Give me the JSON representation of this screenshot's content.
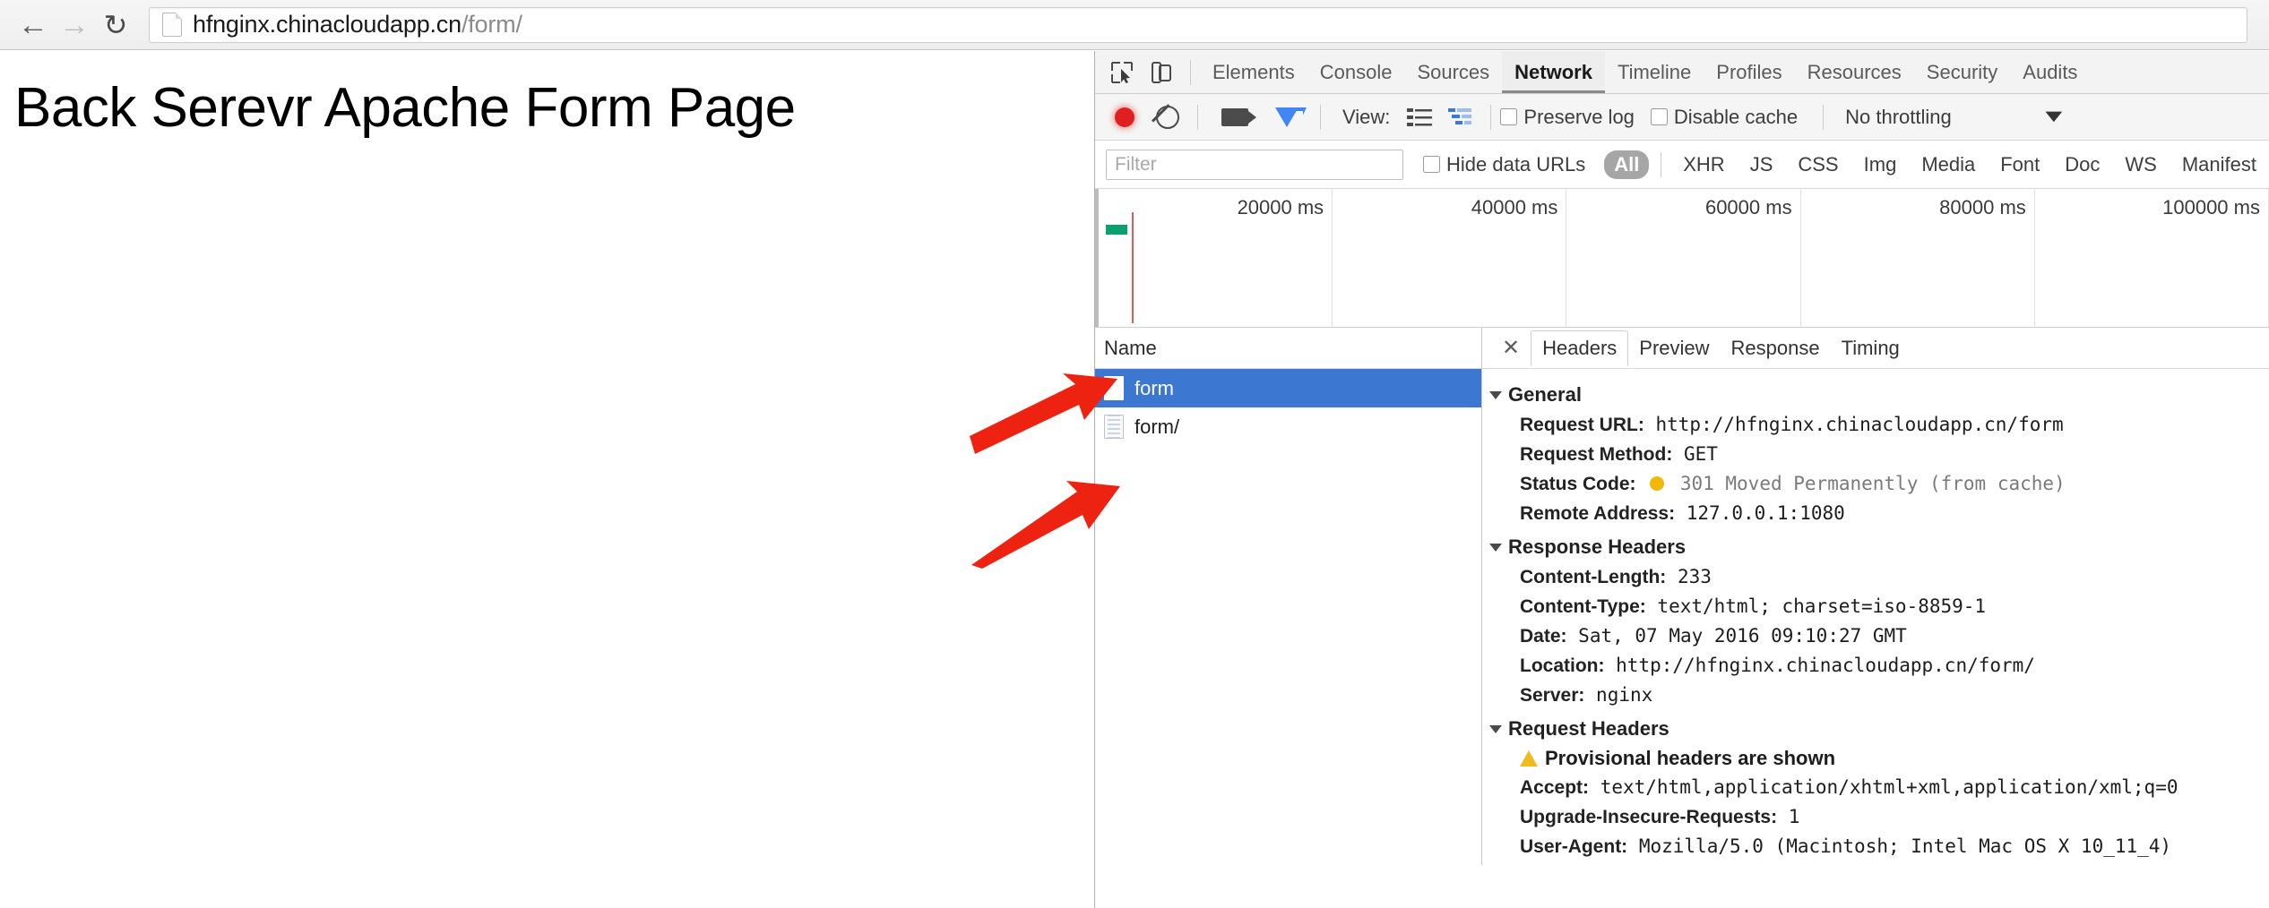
{
  "browser": {
    "back_icon": "back-arrow-icon",
    "forward_icon": "forward-arrow-icon",
    "reload_icon": "reload-icon",
    "url_main": "hfnginx.chinacloudapp.cn",
    "url_path": "/form/",
    "url_full": "hfnginx.chinacloudapp.cn/form/"
  },
  "page": {
    "heading": "Back Serevr Apache Form Page"
  },
  "devtools": {
    "panel_tabs": [
      {
        "label": "Elements",
        "active": false
      },
      {
        "label": "Console",
        "active": false
      },
      {
        "label": "Sources",
        "active": false
      },
      {
        "label": "Network",
        "active": true
      },
      {
        "label": "Timeline",
        "active": false
      },
      {
        "label": "Profiles",
        "active": false
      },
      {
        "label": "Resources",
        "active": false
      },
      {
        "label": "Security",
        "active": false
      },
      {
        "label": "Audits",
        "active": false
      }
    ],
    "toolbar": {
      "record_icon": "record-button-icon",
      "clear_icon": "clear-icon",
      "screenshots_icon": "camera-icon",
      "filter_icon": "funnel-icon",
      "view_label": "View:",
      "view_list_icon": "list-view-icon",
      "view_waterfall_icon": "waterfall-view-icon",
      "preserve_log_label": "Preserve log",
      "preserve_log_checked": false,
      "disable_cache_label": "Disable cache",
      "disable_cache_checked": false,
      "throttling_label": "No throttling",
      "throttling_caret": "▼"
    },
    "filter_bar": {
      "filter_placeholder": "Filter",
      "filter_value": "",
      "hide_data_urls_label": "Hide data URLs",
      "hide_data_urls_checked": false,
      "types": [
        {
          "label": "All",
          "active": true
        },
        {
          "label": "XHR",
          "active": false
        },
        {
          "label": "JS",
          "active": false
        },
        {
          "label": "CSS",
          "active": false
        },
        {
          "label": "Img",
          "active": false
        },
        {
          "label": "Media",
          "active": false
        },
        {
          "label": "Font",
          "active": false
        },
        {
          "label": "Doc",
          "active": false
        },
        {
          "label": "WS",
          "active": false
        },
        {
          "label": "Manifest",
          "active": false
        }
      ]
    },
    "overview": {
      "ticks": [
        "20000 ms",
        "40000 ms",
        "60000 ms",
        "80000 ms",
        "100000 ms"
      ],
      "load_event_color": "#e05c5c",
      "dom_content_loaded_color": "#0aa16e"
    },
    "requests": {
      "column_header": "Name",
      "rows": [
        {
          "name": "form",
          "selected": true
        },
        {
          "name": "form/",
          "selected": false
        }
      ]
    },
    "details": {
      "close_icon": "close-icon",
      "tabs": [
        {
          "label": "Headers",
          "active": true
        },
        {
          "label": "Preview",
          "active": false
        },
        {
          "label": "Response",
          "active": false
        },
        {
          "label": "Timing",
          "active": false
        }
      ],
      "sections": [
        {
          "title": "General",
          "rows": [
            {
              "name": "Request URL:",
              "value": "http://hfnginx.chinacloudapp.cn/form",
              "kind": "plain"
            },
            {
              "name": "Request Method:",
              "value": "GET",
              "kind": "plain"
            },
            {
              "name": "Status Code:",
              "value": "301 Moved Permanently (from cache)",
              "kind": "status"
            },
            {
              "name": "Remote Address:",
              "value": "127.0.0.1:1080",
              "kind": "plain"
            }
          ]
        },
        {
          "title": "Response Headers",
          "rows": [
            {
              "name": "Content-Length:",
              "value": "233",
              "kind": "plain"
            },
            {
              "name": "Content-Type:",
              "value": "text/html; charset=iso-8859-1",
              "kind": "plain"
            },
            {
              "name": "Date:",
              "value": "Sat, 07 May 2016 09:10:27 GMT",
              "kind": "plain"
            },
            {
              "name": "Location:",
              "value": "http://hfnginx.chinacloudapp.cn/form/",
              "kind": "plain"
            },
            {
              "name": "Server:",
              "value": "nginx",
              "kind": "plain"
            }
          ]
        },
        {
          "title": "Request Headers",
          "warning": "Provisional headers are shown",
          "rows": [
            {
              "name": "Accept:",
              "value": "text/html,application/xhtml+xml,application/xml;q=0",
              "kind": "plain"
            },
            {
              "name": "Upgrade-Insecure-Requests:",
              "value": "1",
              "kind": "plain"
            },
            {
              "name": "User-Agent:",
              "value": "Mozilla/5.0 (Macintosh; Intel Mac OS X 10_11_4)",
              "kind": "plain"
            }
          ]
        }
      ]
    }
  },
  "annotations": {
    "arrow_color": "#ee2211",
    "arrow_top_target": "form",
    "arrow_bottom_target": "form/"
  }
}
